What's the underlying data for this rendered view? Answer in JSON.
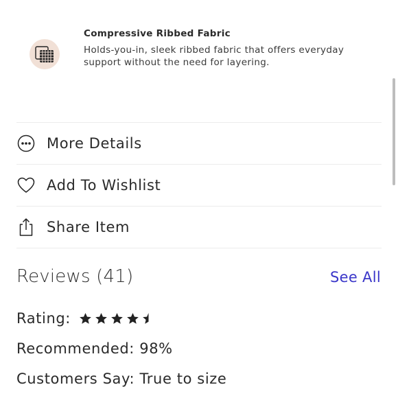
{
  "feature": {
    "icon": "fabric-swatch-icon",
    "title": "Compressive Ribbed Fabric",
    "description": "Holds-you-in, sleek ribbed fabric that offers everyday support without the need for layering."
  },
  "actions": [
    {
      "label": "More Details",
      "icon": "more-dots-icon"
    },
    {
      "label": "Add To Wishlist",
      "icon": "heart-icon"
    },
    {
      "label": "Share Item",
      "icon": "share-icon"
    }
  ],
  "reviews": {
    "title": "Reviews (41)",
    "see_all": "See All",
    "rating_label": "Rating:",
    "rating_value": 4.5,
    "rating_max": 5,
    "recommended": "Recommended: 98%",
    "customers_say": "Customers Say: True to size"
  },
  "colors": {
    "link": "#3a36c9",
    "text": "#2a2a2a",
    "swatch_bg": "#f1e0d6",
    "divider": "#ececec"
  }
}
